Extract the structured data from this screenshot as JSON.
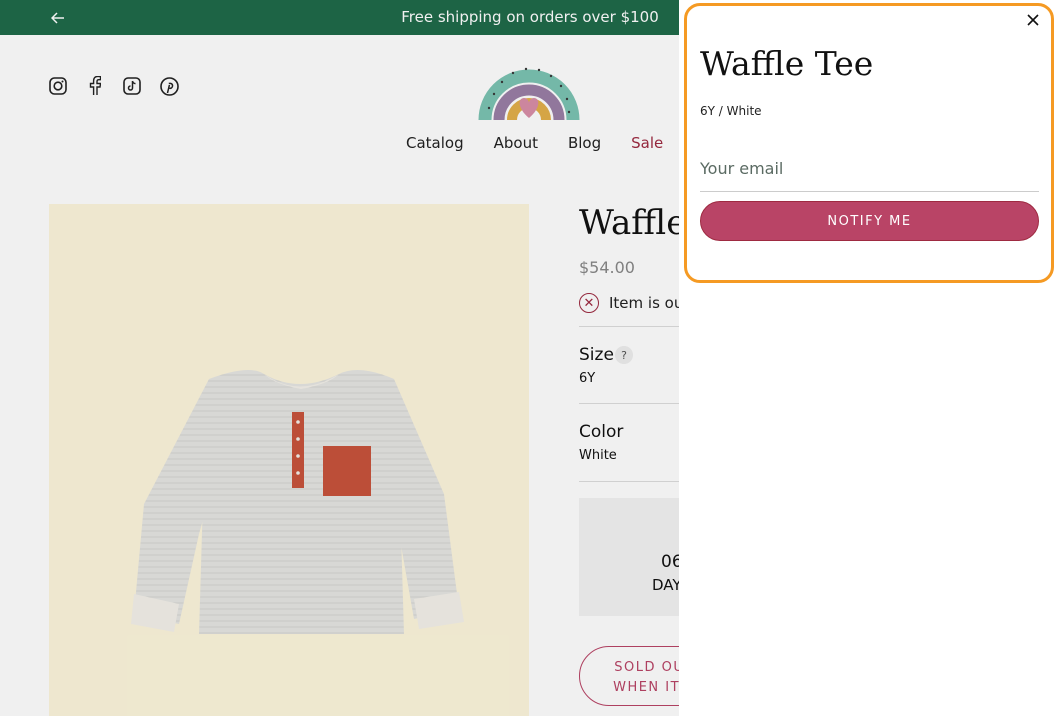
{
  "announcement": {
    "text": "Free shipping on orders over $100"
  },
  "header": {
    "socials": [
      "instagram-icon",
      "facebook-icon",
      "tiktok-icon",
      "pinterest-icon"
    ],
    "nav": [
      {
        "label": "Catalog"
      },
      {
        "label": "About"
      },
      {
        "label": "Blog"
      },
      {
        "label": "Sale"
      }
    ]
  },
  "product": {
    "title": "Waffle",
    "price": "$54.00",
    "stock_text": "Item is out",
    "size_label": "Size",
    "size_value": "6Y",
    "size_help": "?",
    "color_label": "Color",
    "color_value": "White",
    "countdown_number": "06",
    "countdown_unit": "DAY",
    "soldout_line1": "SOLD OUT",
    "soldout_line2": "WHEN IT'S"
  },
  "drawer": {
    "title": "Waffle Tee",
    "variant": "6Y / White",
    "email_placeholder": "Your email",
    "notify_label": "NOTIFY ME",
    "highlight_color": "#f59a23"
  },
  "colors": {
    "brand_green": "#1f6b4a",
    "sale_red": "#9e2a41",
    "button_pink": "#b94466"
  }
}
